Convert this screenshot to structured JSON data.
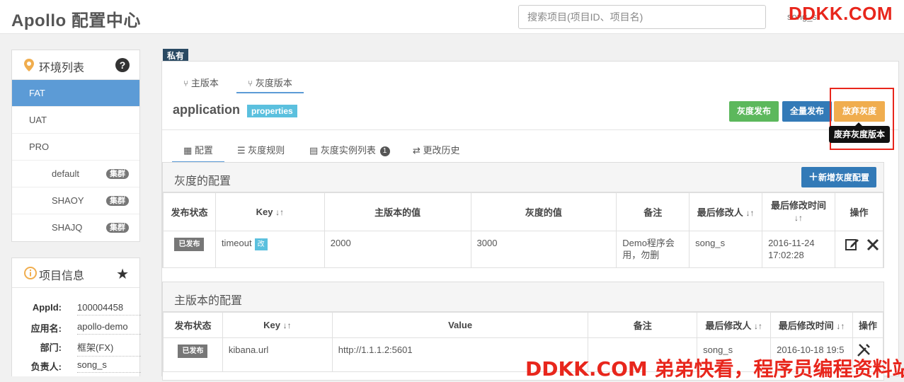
{
  "app": {
    "title": "Apollo 配置中心"
  },
  "search": {
    "placeholder": "搜索项目(项目ID、项目名)"
  },
  "user": {
    "text": "song_s"
  },
  "watermark": {
    "top": "DDKK.COM",
    "bottom": "DDKK.COM 弟弟快看，程序员编程资料站"
  },
  "env_panel": {
    "title": "环境列表",
    "help": "?",
    "items": [
      {
        "label": "FAT",
        "active": true
      },
      {
        "label": "UAT"
      },
      {
        "label": "PRO"
      }
    ],
    "clusters": [
      {
        "label": "default",
        "badge": "集群"
      },
      {
        "label": "SHAOY",
        "badge": "集群"
      },
      {
        "label": "SHAJQ",
        "badge": "集群"
      }
    ]
  },
  "info_panel": {
    "title": "项目信息",
    "rows": [
      {
        "label": "AppId:",
        "value": "100004458"
      },
      {
        "label": "应用名:",
        "value": "apollo-demo"
      },
      {
        "label": "部门:",
        "value": "框架(FX)"
      },
      {
        "label": "负责人:",
        "value": "song_s"
      }
    ]
  },
  "namespace": {
    "tag": "私有",
    "tabs": [
      "主版本",
      "灰度版本"
    ],
    "name": "application",
    "format": "properties",
    "buttons": {
      "gray_release": "灰度发布",
      "full_release": "全量发布",
      "abandon": "放弃灰度"
    },
    "tooltip": "废弃灰度版本",
    "subtabs": [
      "配置",
      "灰度规则",
      "灰度实例列表",
      "更改历史"
    ],
    "instance_count": "1"
  },
  "gray_config": {
    "title": "灰度的配置",
    "add_button": "新增灰度配置",
    "headers": [
      "发布状态",
      "Key",
      "主版本的值",
      "灰度的值",
      "备注",
      "最后修改人",
      "最后修改时间",
      "操作"
    ],
    "rows": [
      {
        "status": "已发布",
        "key": "timeout",
        "key_badge": "改",
        "master_value": "2000",
        "gray_value": "3000",
        "comment": "Demo程序会用，勿删",
        "modifier": "song_s",
        "time": "2016-11-24 17:02:28"
      }
    ]
  },
  "master_config": {
    "title": "主版本的配置",
    "headers": [
      "发布状态",
      "Key",
      "Value",
      "备注",
      "最后修改人",
      "最后修改时间",
      "操作"
    ],
    "rows": [
      {
        "status": "已发布",
        "key": "kibana.url",
        "value": "http://1.1.1.2:5601",
        "comment": "",
        "modifier": "song_s",
        "time": "2016-10-18 19:5"
      }
    ]
  }
}
